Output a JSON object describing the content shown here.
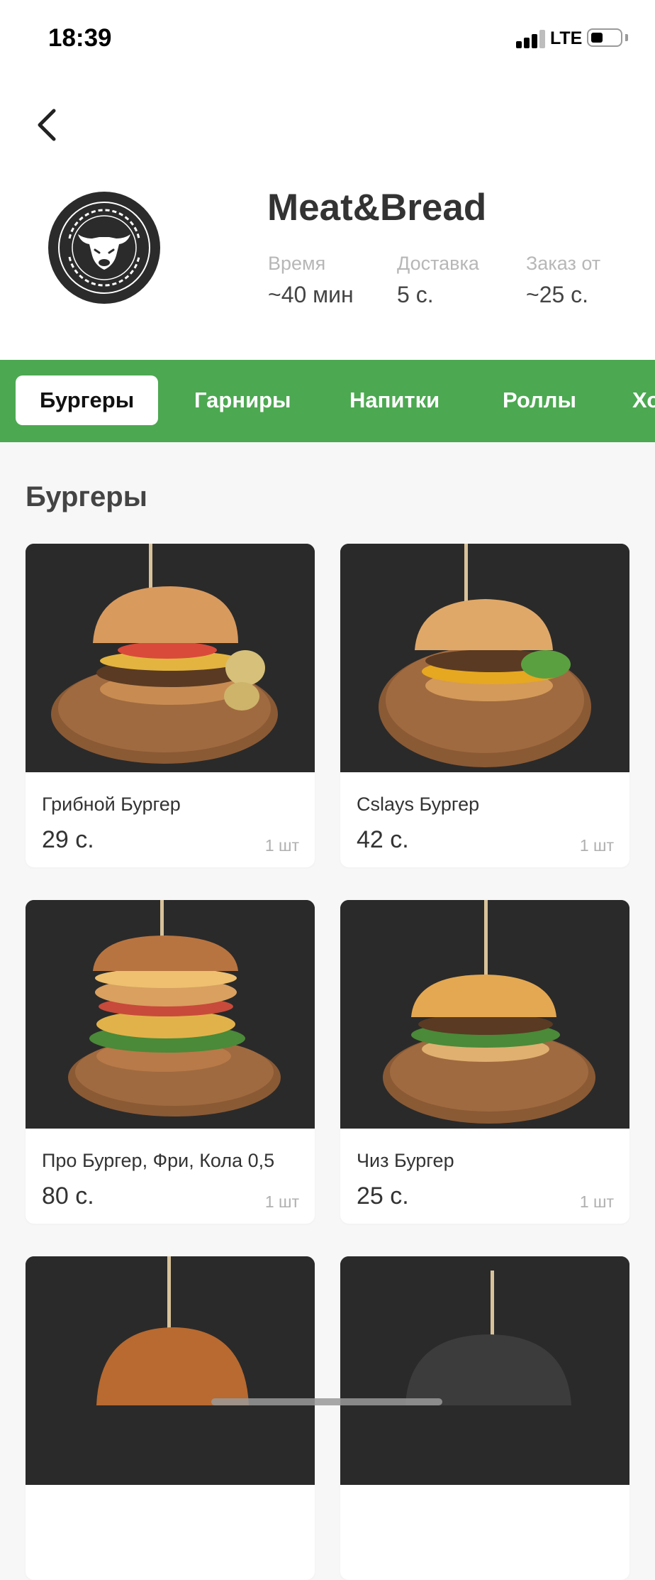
{
  "status": {
    "time": "18:39",
    "network": "LTE"
  },
  "shop": {
    "name": "Meat&Bread",
    "info": [
      {
        "label": "Время",
        "value": "~40 мин"
      },
      {
        "label": "Доставка",
        "value": "5 с."
      },
      {
        "label": "Заказ от",
        "value": "~25 с."
      }
    ]
  },
  "tabs": [
    {
      "label": "Бургеры",
      "active": true
    },
    {
      "label": "Гарниры"
    },
    {
      "label": "Напитки"
    },
    {
      "label": "Роллы"
    },
    {
      "label": "Хо"
    }
  ],
  "section": {
    "title": "Бургеры"
  },
  "products": [
    {
      "name": "Грибной Бургер",
      "price": "29 с.",
      "qty": "1 шт"
    },
    {
      "name": "Cslays Бургер",
      "price": "42 с.",
      "qty": "1 шт"
    },
    {
      "name": "Про Бургер, Фри, Кола 0,5",
      "price": "80 с.",
      "qty": "1 шт"
    },
    {
      "name": "Чиз Бургер",
      "price": "25 с.",
      "qty": "1 шт"
    },
    {
      "name": "",
      "price": "",
      "qty": ""
    },
    {
      "name": "",
      "price": "",
      "qty": ""
    }
  ],
  "colors": {
    "brand_green": "#4ca851",
    "logo_dark": "#2b2b2b",
    "photo_bg": "#2a2a2a"
  },
  "icons": [
    "back-chevron-icon",
    "signal-icon",
    "battery-icon",
    "bull-logo-icon"
  ]
}
